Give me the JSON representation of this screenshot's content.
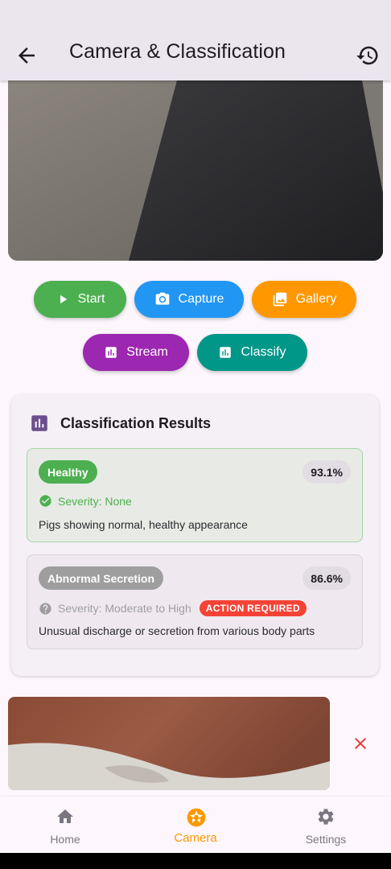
{
  "app_bar": {
    "title": "Camera & Classification",
    "back_icon": "arrow-back-icon",
    "history_icon": "history-icon"
  },
  "camera_preview": {
    "label": ""
  },
  "actions": {
    "start": "Start",
    "capture": "Capture",
    "gallery": "Gallery",
    "stream": "Stream",
    "classify": "Classify",
    "colors": {
      "start": "#4caf50",
      "capture": "#2196f3",
      "gallery": "#ff9800",
      "stream": "#9c27b0",
      "classify": "#009688"
    }
  },
  "results": {
    "title": "Classification Results",
    "items": [
      {
        "label": "Healthy",
        "confidence": "93.1%",
        "severity": "Severity: None",
        "severity_icon": "check-circle-icon",
        "description": "Pigs showing normal, healthy appearance",
        "color": "#4caf50"
      },
      {
        "label": "Abnormal Secretion",
        "confidence": "86.6%",
        "severity": "Severity: Moderate to High",
        "severity_icon": "help-circle-icon",
        "badge": "ACTION REQUIRED",
        "description": "Unusual discharge or secretion from various body parts",
        "color": "#9e9e9e"
      }
    ]
  },
  "bottom_nav": {
    "items": [
      {
        "label": "Home",
        "icon": "home-icon"
      },
      {
        "label": "Camera",
        "icon": "camera-shutter-icon",
        "active": true
      },
      {
        "label": "Settings",
        "icon": "gear-icon"
      }
    ],
    "active_color": "#ff9800"
  }
}
